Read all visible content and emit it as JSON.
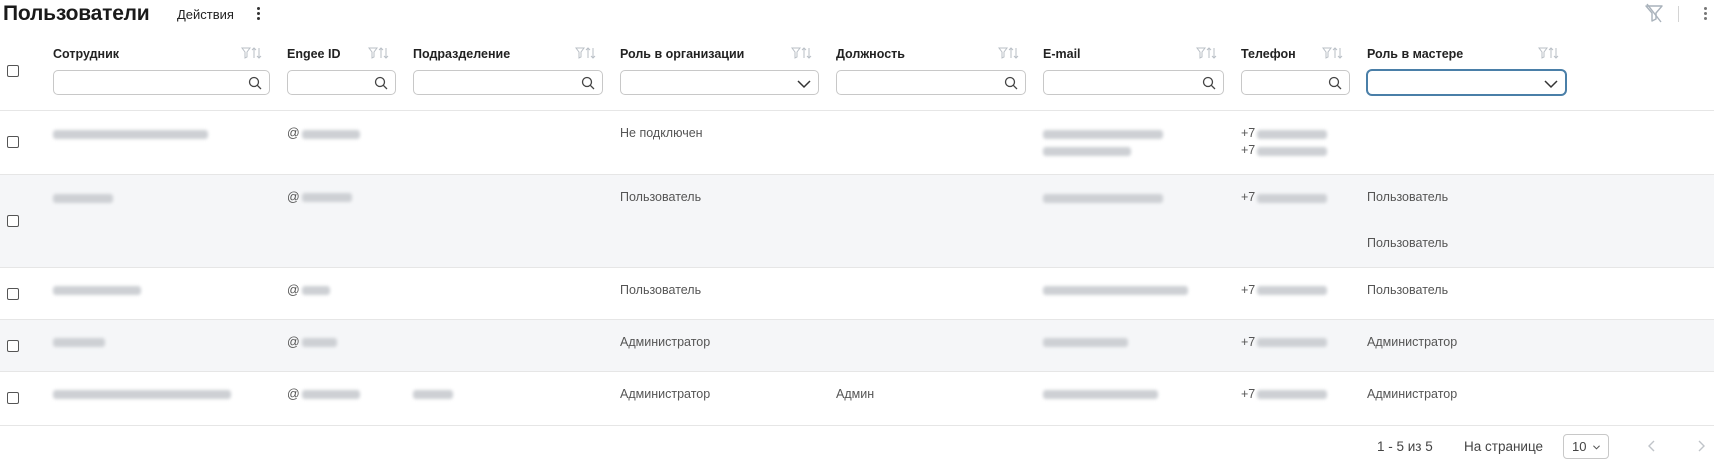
{
  "header": {
    "title": "Пользователи",
    "actions_label": "Действия",
    "icons": [
      "more-vertical-icon",
      "filter-off-icon"
    ]
  },
  "table": {
    "columns": [
      {
        "label": "Сотрудник",
        "filter": "search"
      },
      {
        "label": "Engee ID",
        "filter": "search"
      },
      {
        "label": "Подразделение",
        "filter": "search"
      },
      {
        "label": "Роль в организации",
        "filter": "select"
      },
      {
        "label": "Должность",
        "filter": "search"
      },
      {
        "label": "E-mail",
        "filter": "search"
      },
      {
        "label": "Телефон",
        "filter": "search"
      },
      {
        "label": "Роль в мастере",
        "filter": "select"
      }
    ],
    "rows": [
      {
        "engee_prefix": "@",
        "org_role": "Не подключен",
        "position": "",
        "phone_prefix": "+7",
        "phone2_prefix": "+7",
        "master_role": "",
        "master_role2": ""
      },
      {
        "engee_prefix": "@",
        "org_role": "Пользователь",
        "position": "",
        "phone_prefix": "+7",
        "master_role": "Пользователь",
        "master_role2": "Пользователь"
      },
      {
        "engee_prefix": "@",
        "org_role": "Пользователь",
        "position": "",
        "phone_prefix": "+7",
        "master_role": "Пользователь"
      },
      {
        "engee_prefix": "@",
        "org_role": "Администратор",
        "position": "",
        "phone_prefix": "+7",
        "master_role": "Администратор"
      },
      {
        "engee_prefix": "@",
        "org_role": "Администратор",
        "position": "Админ",
        "phone_prefix": "+7",
        "master_role": "Администратор"
      }
    ]
  },
  "footer": {
    "range_text": "1 - 5 из 5",
    "per_page_label": "На странице",
    "per_page_value": "10"
  }
}
